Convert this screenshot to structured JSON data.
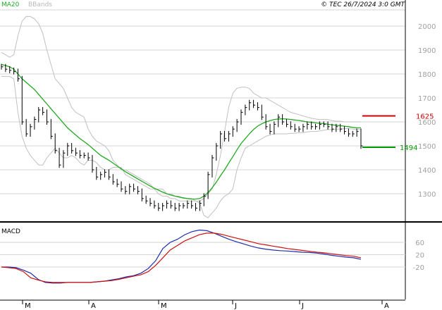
{
  "header": {
    "legend_ma": "MA20",
    "legend_bb": "BBands",
    "copyright": "© TEC 26/7/2024 3:0 GMT"
  },
  "colors": {
    "background": "#ffffff",
    "price_bar": "#000000",
    "ma20": "#22aa22",
    "bbands": "#c0c0c0",
    "resistance": "#cc0000",
    "support": "#009900",
    "macd_line": "#1f2fa8",
    "signal_line": "#cc1111",
    "grid": "#d4d4d4",
    "axis_text": "#a0a0a0"
  },
  "chart_data": [
    {
      "type": "line",
      "title": "",
      "ylim": [
        1200,
        2100
      ],
      "y_ticks": [
        1300,
        1400,
        1500,
        1600,
        1700,
        1800,
        1900,
        2000
      ],
      "y_tick_labels": [
        "1300",
        "1400",
        "1500",
        "1600",
        "1700",
        "1800",
        "1900",
        "2000"
      ],
      "x_month_labels": [
        "M",
        "A",
        "M",
        "J",
        "J",
        "A"
      ],
      "price": [
        1830,
        1820,
        1815,
        1810,
        1780,
        1600,
        1550,
        1580,
        1610,
        1650,
        1640,
        1600,
        1540,
        1480,
        1420,
        1470,
        1500,
        1480,
        1470,
        1460,
        1460,
        1450,
        1400,
        1370,
        1380,
        1390,
        1370,
        1350,
        1340,
        1320,
        1310,
        1330,
        1320,
        1310,
        1280,
        1270,
        1260,
        1250,
        1240,
        1250,
        1260,
        1250,
        1240,
        1250,
        1250,
        1260,
        1250,
        1240,
        1260,
        1290,
        1380,
        1450,
        1500,
        1550,
        1530,
        1550,
        1570,
        1600,
        1640,
        1660,
        1680,
        1670,
        1660,
        1620,
        1580,
        1560,
        1590,
        1620,
        1600,
        1590,
        1580,
        1570,
        1570,
        1580,
        1590,
        1580,
        1580,
        1590,
        1590,
        1580,
        1570,
        1580,
        1570,
        1560,
        1550,
        1550,
        1560,
        1500
      ],
      "ma20": [
        1840,
        1835,
        1830,
        1820,
        1800,
        1780,
        1765,
        1750,
        1735,
        1715,
        1695,
        1675,
        1655,
        1635,
        1615,
        1595,
        1575,
        1560,
        1545,
        1530,
        1518,
        1505,
        1490,
        1475,
        1460,
        1450,
        1440,
        1428,
        1416,
        1404,
        1392,
        1382,
        1372,
        1362,
        1352,
        1342,
        1332,
        1323,
        1315,
        1307,
        1300,
        1295,
        1290,
        1286,
        1283,
        1280,
        1278,
        1278,
        1280,
        1290,
        1305,
        1325,
        1348,
        1375,
        1400,
        1428,
        1455,
        1483,
        1510,
        1530,
        1550,
        1568,
        1582,
        1592,
        1600,
        1605,
        1610,
        1612,
        1613,
        1612,
        1610,
        1608,
        1606,
        1603,
        1600,
        1598,
        1596,
        1594,
        1593,
        1590,
        1588,
        1586,
        1584,
        1582,
        1580,
        1577,
        1575,
        1575
      ],
      "bb_upper": [
        1890,
        1880,
        1870,
        1880,
        1960,
        2020,
        2040,
        2040,
        2030,
        2010,
        1970,
        1900,
        1840,
        1780,
        1760,
        1740,
        1700,
        1660,
        1640,
        1630,
        1620,
        1570,
        1540,
        1520,
        1510,
        1500,
        1480,
        1440,
        1420,
        1400,
        1400,
        1390,
        1380,
        1370,
        1360,
        1350,
        1340,
        1320,
        1300,
        1290,
        1290,
        1280,
        1280,
        1270,
        1270,
        1270,
        1270,
        1270,
        1270,
        1280,
        1300,
        1320,
        1380,
        1460,
        1560,
        1660,
        1720,
        1740,
        1745,
        1745,
        1740,
        1720,
        1710,
        1700,
        1700,
        1690,
        1680,
        1670,
        1660,
        1650,
        1640,
        1635,
        1630,
        1625,
        1620,
        1615,
        1612,
        1610,
        1610,
        1610,
        1605,
        1603,
        1603,
        1600,
        1600,
        1600,
        1600,
        1600
      ],
      "bb_lower": [
        1790,
        1790,
        1790,
        1780,
        1640,
        1540,
        1490,
        1460,
        1440,
        1420,
        1420,
        1450,
        1470,
        1490,
        1470,
        1450,
        1450,
        1460,
        1450,
        1430,
        1420,
        1440,
        1440,
        1430,
        1410,
        1400,
        1400,
        1410,
        1410,
        1410,
        1380,
        1370,
        1360,
        1350,
        1340,
        1330,
        1320,
        1320,
        1320,
        1320,
        1300,
        1300,
        1290,
        1290,
        1280,
        1280,
        1280,
        1270,
        1260,
        1210,
        1200,
        1220,
        1240,
        1270,
        1290,
        1300,
        1320,
        1400,
        1450,
        1490,
        1500,
        1510,
        1520,
        1530,
        1540,
        1545,
        1550,
        1550,
        1550,
        1550,
        1552,
        1552,
        1555,
        1555,
        1558,
        1560,
        1560,
        1562,
        1565,
        1568,
        1568,
        1570,
        1570,
        1572,
        1572,
        1570,
        1568,
        1568
      ],
      "annotations": [
        {
          "label": "1625",
          "value": 1625,
          "kind": "resistance"
        },
        {
          "label": "1494",
          "value": 1494,
          "kind": "support"
        }
      ]
    },
    {
      "type": "line",
      "title": "MACD",
      "ylim": [
        -110,
        110
      ],
      "y_ticks": [
        60,
        20,
        -20
      ],
      "y_tick_labels": [
        "60",
        "20",
        "-20"
      ],
      "series": [
        {
          "role": "macd",
          "values": [
            -20,
            -20,
            -22,
            -30,
            -40,
            -60,
            -70,
            -72,
            -72,
            -70,
            -70,
            -70,
            -70,
            -68,
            -66,
            -62,
            -58,
            -52,
            -48,
            -40,
            -25,
            0,
            40,
            60,
            70,
            85,
            95,
            100,
            98,
            90,
            80,
            70,
            62,
            55,
            48,
            42,
            38,
            35,
            33,
            32,
            30,
            28,
            27,
            25,
            22,
            18,
            15,
            12,
            10,
            5
          ]
        },
        {
          "role": "signal",
          "values": [
            -20,
            -22,
            -25,
            -35,
            -55,
            -62,
            -68,
            -70,
            -70,
            -70,
            -70,
            -70,
            -70,
            -68,
            -66,
            -64,
            -60,
            -55,
            -50,
            -45,
            -35,
            -15,
            10,
            35,
            50,
            65,
            75,
            85,
            90,
            90,
            86,
            80,
            74,
            68,
            62,
            56,
            52,
            48,
            44,
            40,
            37,
            34,
            31,
            28,
            26,
            23,
            20,
            17,
            15,
            10
          ]
        }
      ]
    }
  ]
}
